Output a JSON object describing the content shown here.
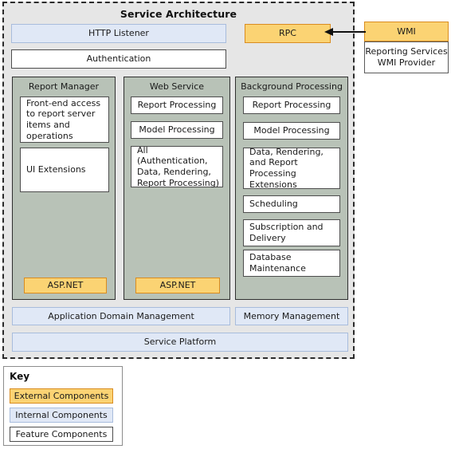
{
  "diagram": {
    "title": "Service Architecture",
    "top_row": {
      "http_listener": "HTTP Listener",
      "rpc": "RPC"
    },
    "authentication": "Authentication",
    "external_provider": {
      "header": "WMI",
      "body": "Reporting Services WMI Provider",
      "arrow_label": "arrow-wmi-to-rpc"
    },
    "panels": [
      {
        "title": "Report Manager",
        "items": [
          "Front-end access to report server items and operations",
          "UI Extensions"
        ],
        "footer": "ASP.NET"
      },
      {
        "title": "Web Service",
        "items": [
          "Report Processing",
          "Model Processing",
          "All (Authentication, Data, Rendering, Report Processing)"
        ],
        "footer": "ASP.NET"
      },
      {
        "title": "Background Processing",
        "items": [
          "Report Processing",
          "Model Processing",
          "Data, Rendering, and Report Processing Extensions",
          "Scheduling",
          "Subscription and Delivery",
          "Database Maintenance"
        ],
        "footer": null
      }
    ],
    "bottom_rows": {
      "application_domain_management": "Application Domain Management",
      "memory_management": "Memory Management",
      "service_platform": "Service Platform"
    }
  },
  "key": {
    "title": "Key",
    "items": [
      {
        "label": "External Components",
        "color": "#fbd373"
      },
      {
        "label": "Internal Components",
        "color": "#e0e8f6"
      },
      {
        "label": "Feature Components",
        "color": "#ffffff"
      }
    ]
  },
  "colors": {
    "external_fill": "#fbd373",
    "external_border": "#d98c20",
    "internal_fill": "#e0e8f6",
    "internal_border": "#a8bcdc",
    "feature_fill": "#ffffff",
    "feature_border": "#4d4d4d",
    "panel_fill": "#b8c2b7",
    "panel_border": "#2f2f2f",
    "container_fill": "#e6e6e6",
    "container_border": "#2b2b2b"
  }
}
